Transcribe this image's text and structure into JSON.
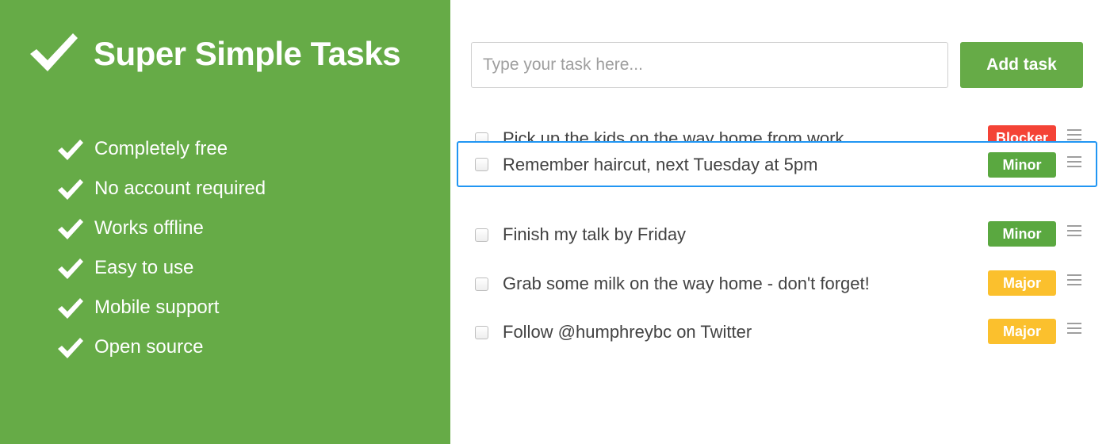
{
  "colors": {
    "brand_green": "#66ab47",
    "blocker": "#f44336",
    "minor": "#5aa840",
    "major": "#fbc02d",
    "selection": "#2196f3"
  },
  "sidebar": {
    "logo_icon": "checkmark-icon",
    "title": "Super Simple Tasks",
    "features": [
      {
        "icon": "checkmark-icon",
        "label": "Completely free"
      },
      {
        "icon": "checkmark-icon",
        "label": "No account required"
      },
      {
        "icon": "checkmark-icon",
        "label": "Works offline"
      },
      {
        "icon": "checkmark-icon",
        "label": "Easy to use"
      },
      {
        "icon": "checkmark-icon",
        "label": "Mobile support"
      },
      {
        "icon": "checkmark-icon",
        "label": "Open source"
      }
    ]
  },
  "task_form": {
    "input_value": "",
    "input_placeholder": "Type your task here...",
    "add_button_label": "Add task"
  },
  "tasks": [
    {
      "text": "Pick up the kids on the way home from work",
      "priority": "Blocker",
      "checked": false,
      "state": "partially-hidden"
    },
    {
      "text": "Remember haircut, next Tuesday at 5pm",
      "priority": "Minor",
      "checked": false,
      "state": "dragging"
    },
    {
      "text": "Finish my talk by Friday",
      "priority": "Minor",
      "checked": false,
      "state": "normal"
    },
    {
      "text": "Grab some milk on the way home - don't forget!",
      "priority": "Major",
      "checked": false,
      "state": "normal"
    },
    {
      "text": "Follow @humphreybc on Twitter",
      "priority": "Major",
      "checked": false,
      "state": "normal"
    }
  ]
}
